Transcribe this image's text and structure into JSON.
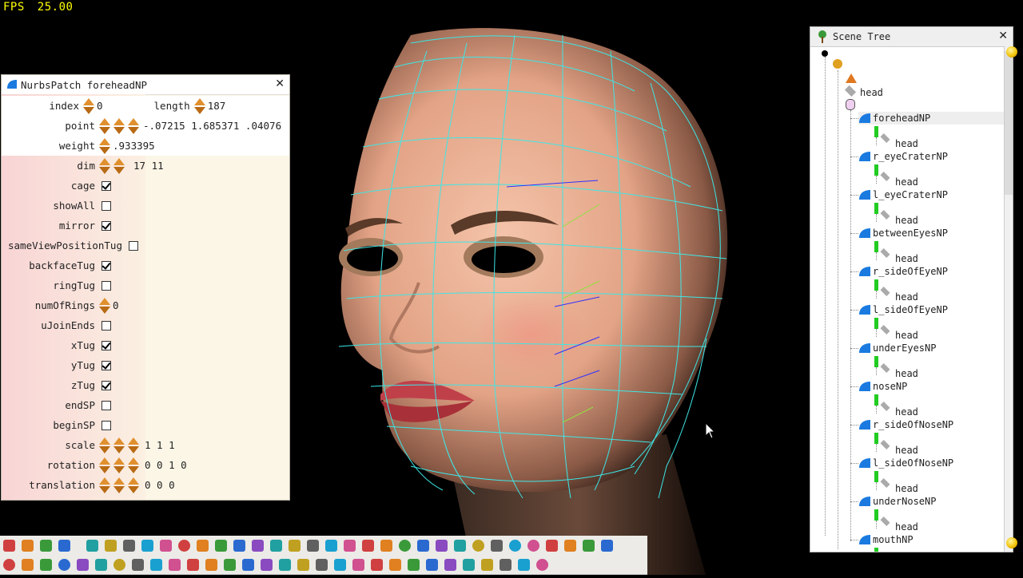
{
  "fps": {
    "label": "FPS",
    "value": "25.00"
  },
  "panel": {
    "title": "NurbsPatch foreheadNP",
    "index_label": "index",
    "index_value": "0",
    "length_label": "length",
    "length_value": "187",
    "point_label": "point",
    "point_value": "-.07215 1.685371 .04076",
    "weight_label": "weight",
    "weight_value": ".933395",
    "dim_label": "dim",
    "dim_value": "17 11",
    "checks": [
      {
        "label": "cage",
        "checked": true
      },
      {
        "label": "showAll",
        "checked": false
      },
      {
        "label": "mirror",
        "checked": true
      },
      {
        "label": "sameViewPositionTug",
        "checked": false
      },
      {
        "label": "backfaceTug",
        "checked": true
      },
      {
        "label": "ringTug",
        "checked": false
      }
    ],
    "numOfRings_label": "numOfRings",
    "numOfRings_value": "0",
    "checks2": [
      {
        "label": "uJoinEnds",
        "checked": false
      },
      {
        "label": "xTug",
        "checked": true
      },
      {
        "label": "yTug",
        "checked": true
      },
      {
        "label": "zTug",
        "checked": true
      },
      {
        "label": "endSP",
        "checked": false
      },
      {
        "label": "beginSP",
        "checked": false
      }
    ],
    "scale_label": "scale",
    "scale_value": "1 1 1",
    "rotation_label": "rotation",
    "rotation_value": "0 0 1 0",
    "translation_label": "translation",
    "translation_value": "0 0 0"
  },
  "scene_tree": {
    "title": "Scene Tree",
    "root_shape": "head",
    "patches": [
      "foreheadNP",
      "r_eyeCraterNP",
      "l_eyeCraterNP",
      "betweenEyesNP",
      "r_sideOfEyeNP",
      "l_sideOfEyeNP",
      "underEyesNP",
      "noseNP",
      "r_sideOfNoseNP",
      "l_sideOfNoseNP",
      "underNoseNP",
      "mouthNP"
    ],
    "child_label": "head",
    "selected": "foreheadNP"
  },
  "colors": {
    "wireframe": "#3ee6e6",
    "fps_text": "#ffff00",
    "panel_bg": "#fcf6e6",
    "skin": "#e8a888"
  },
  "toolbar_top": [
    "new-icon",
    "open-icon",
    "open-folder-icon",
    "save-icon",
    "spacer",
    "import-icon",
    "tree-icon",
    "copy-icon",
    "undo-icon",
    "redo-icon",
    "ball-icon",
    "grid-icon",
    "brick-icon",
    "box-icon",
    "window-icon",
    "crop-icon",
    "zoom-icon",
    "face-icon",
    "face-icon",
    "face-icon",
    "face-icon",
    "head-icon",
    "globe-icon",
    "pill-icon",
    "move-icon",
    "move2-icon",
    "rotate-icon",
    "square-icon",
    "target-icon",
    "target2-icon",
    "mask-icon",
    "arrow-up-icon",
    "pole-icon",
    "help-icon"
  ],
  "toolbar_bottom": [
    "sphere-icon",
    "cylinder-icon",
    "cone-icon",
    "torus-icon",
    "figure-icon",
    "cube-icon",
    "ring-icon",
    "checker-icon",
    "shield-icon",
    "light-icon",
    "frame-icon",
    "leaf-icon",
    "material-icon",
    "square2-icon",
    "timer-icon",
    "lock-icon",
    "seq-icon",
    "node-icon",
    "text-icon",
    "bulb-icon",
    "arrows-icon",
    "triangle-icon",
    "count-icon",
    "tag-icon",
    "wand-icon",
    "dots-icon",
    "landscape-icon",
    "bridge-icon",
    "pole2-icon",
    "compass-icon"
  ]
}
